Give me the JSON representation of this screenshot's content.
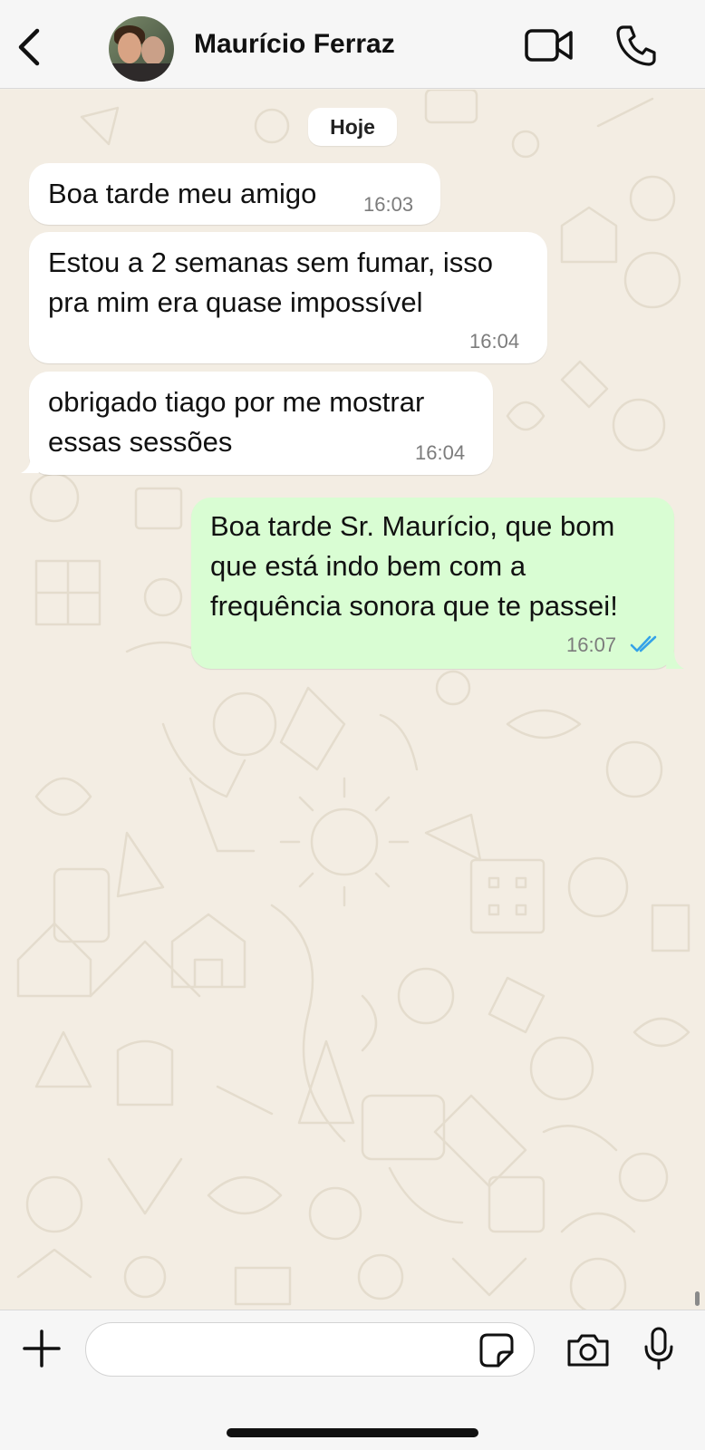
{
  "header": {
    "back_icon": "chevron-left-icon",
    "contact_name": "Maurício Ferraz",
    "avatar_icon": "contact-photo",
    "video_icon": "video-camera-icon",
    "call_icon": "phone-icon"
  },
  "chat": {
    "date_label": "Hoje",
    "messages": [
      {
        "direction": "incoming",
        "lines": [
          "Boa tarde meu amigo"
        ],
        "time": "16:03"
      },
      {
        "direction": "incoming",
        "lines": [
          "Estou a 2 semanas sem fumar, isso",
          "pra mim era quase impossível"
        ],
        "time": "16:04"
      },
      {
        "direction": "incoming",
        "lines": [
          "obrigado tiago por me mostrar",
          "essas sessões"
        ],
        "time": "16:04"
      },
      {
        "direction": "outgoing",
        "lines": [
          "Boa tarde Sr. Maurício, que bom",
          "que está indo bem com a",
          "frequência sonora que te passei!"
        ],
        "time": "16:07",
        "status": "read",
        "status_icon": "double-check-icon"
      }
    ]
  },
  "composer": {
    "plus_icon": "plus-icon",
    "input_value": "",
    "input_placeholder": "",
    "sticker_icon": "sticker-icon",
    "camera_icon": "camera-icon",
    "mic_icon": "microphone-icon"
  },
  "colors": {
    "incoming_bubble": "#ffffff",
    "outgoing_bubble": "#d9fdd3",
    "read_ticks": "#34a2e8",
    "chat_background": "#f3ede3"
  }
}
